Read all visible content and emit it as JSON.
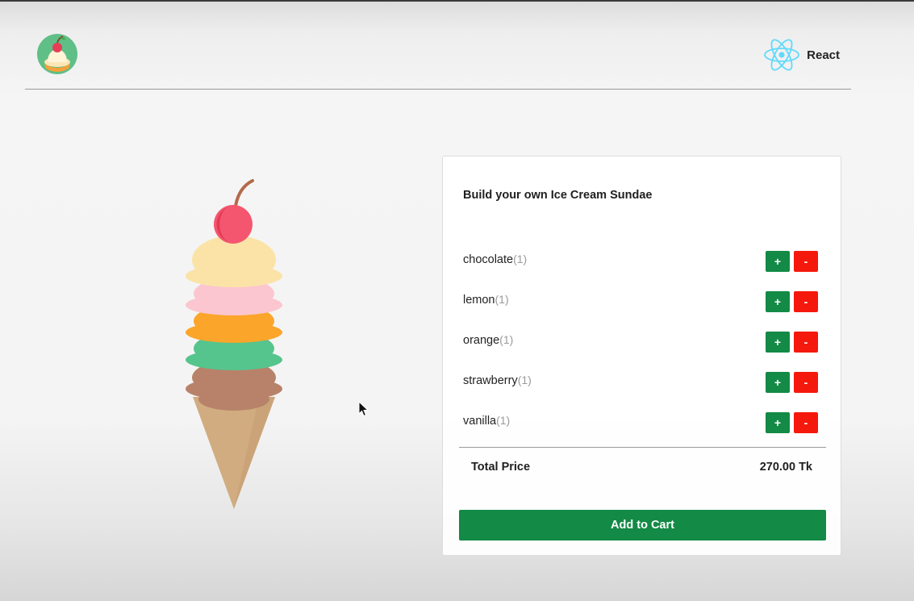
{
  "header": {
    "logo_icon": "sundae-logo-icon",
    "brand_icon": "react-icon",
    "brand_label": "React"
  },
  "builder": {
    "title": "Build your own Ice Cream Sundae",
    "flavors": [
      {
        "name": "chocolate",
        "count": "(1)",
        "add_label": "+",
        "remove_label": "-"
      },
      {
        "name": "lemon",
        "count": "(1)",
        "add_label": "+",
        "remove_label": "-"
      },
      {
        "name": "orange",
        "count": "(1)",
        "add_label": "+",
        "remove_label": "-"
      },
      {
        "name": "strawberry",
        "count": "(1)",
        "add_label": "+",
        "remove_label": "-"
      },
      {
        "name": "vanilla",
        "count": "(1)",
        "add_label": "+",
        "remove_label": "-"
      }
    ],
    "total_label": "Total Price",
    "total_value": "270.00 Tk",
    "cart_button_label": "Add to Cart"
  },
  "colors": {
    "add_button": "#138a45",
    "remove_button": "#f5180c",
    "cart_button": "#138a45",
    "scoop_vanilla": "#fbe3a8",
    "scoop_strawberry": "#fbc6cf",
    "scoop_orange": "#fba52a",
    "scoop_lemon": "#56c48d",
    "scoop_chocolate": "#b8826a",
    "cone": "#d1ac80",
    "cherry": "#f4566f"
  }
}
